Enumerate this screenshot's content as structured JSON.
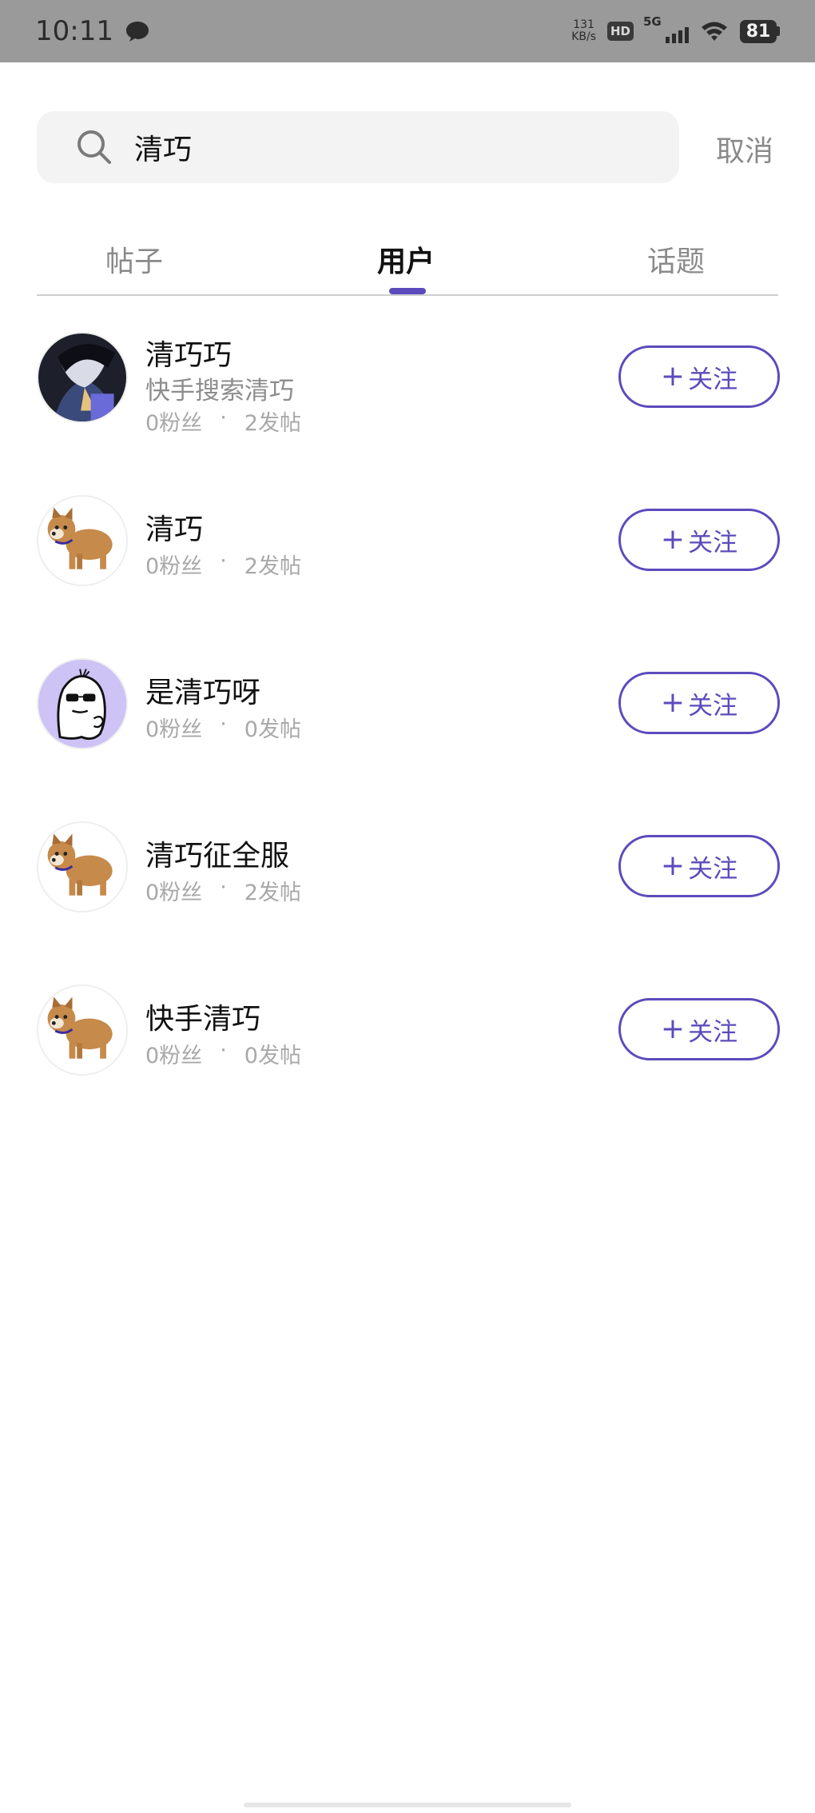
{
  "status_bar": {
    "time": "10:11",
    "net_speed_value": "131",
    "net_speed_unit": "KB/s",
    "hd_label": "HD",
    "network": "5G",
    "battery": "81"
  },
  "search": {
    "query": "清巧",
    "cancel_label": "取消"
  },
  "tabs": [
    {
      "label": "帖子",
      "active": false
    },
    {
      "label": "用户",
      "active": true
    },
    {
      "label": "话题",
      "active": false
    }
  ],
  "accent_color": "#5b4bbd",
  "users": [
    {
      "name": "清巧巧",
      "desc": "快手搜索清巧",
      "fans": "0粉丝",
      "sep": "·",
      "posts": "2发帖",
      "avatar": "anime-character-avatar",
      "follow_label": "关注"
    },
    {
      "name": "清巧",
      "fans": "0粉丝",
      "sep": "·",
      "posts": "2发帖",
      "avatar": "shiba-dog-avatar",
      "follow_label": "关注"
    },
    {
      "name": "是清巧呀",
      "fans": "0粉丝",
      "sep": "·",
      "posts": "0发帖",
      "avatar": "ghost-sunglasses-avatar",
      "follow_label": "关注"
    },
    {
      "name": "清巧征全服",
      "fans": "0粉丝",
      "sep": "·",
      "posts": "2发帖",
      "avatar": "shiba-dog-avatar",
      "follow_label": "关注"
    },
    {
      "name": "快手清巧",
      "fans": "0粉丝",
      "sep": "·",
      "posts": "0发帖",
      "avatar": "shiba-dog-avatar",
      "follow_label": "关注"
    }
  ]
}
